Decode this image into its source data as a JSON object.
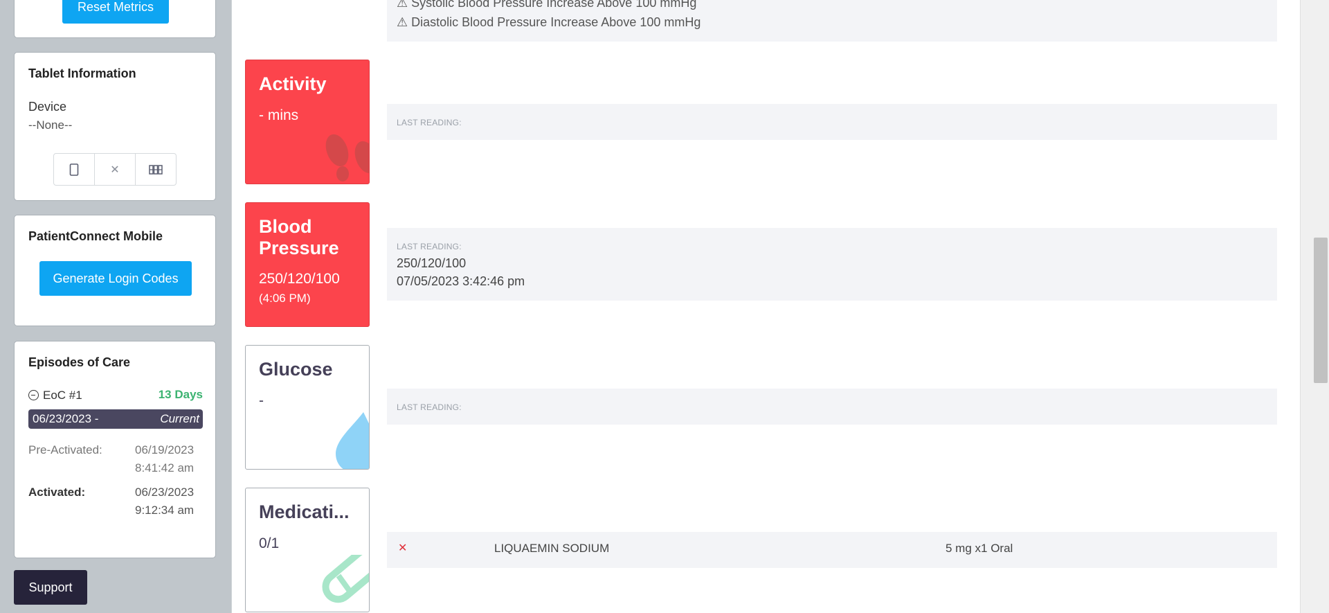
{
  "sidebar": {
    "reset_metrics": "Reset Metrics",
    "tablet": {
      "title": "Tablet Information",
      "device_label": "Device",
      "device_value": "--None--",
      "tablet_icon": "tablet-icon",
      "clear_icon": "close-icon",
      "grid_icon": "tablet-grid-icon"
    },
    "patient_connect": {
      "title": "PatientConnect Mobile",
      "button": "Generate Login Codes"
    },
    "episodes": {
      "title": "Episodes of Care",
      "eoc_label": "EoC #1",
      "eoc_days": "13 Days",
      "range_start": "06/23/2023 -",
      "range_end": "Current",
      "pre_activated_label": "Pre-Activated:",
      "pre_activated_date": "06/19/2023",
      "pre_activated_time": "8:41:42 am",
      "activated_label": "Activated:",
      "activated_date": "06/23/2023",
      "activated_time": "9:12:34 am"
    },
    "support": "Support"
  },
  "alerts": {
    "systolic": "Systolic Blood Pressure Increase Above 100 mmHg",
    "diastolic": "Diastolic Blood Pressure Increase Above 100 mmHg"
  },
  "tiles": {
    "activity": {
      "title": "Activity",
      "value": "- mins",
      "icon": "footprints-icon"
    },
    "bp": {
      "title_1": "Blood",
      "title_2": "Pressure",
      "value": "250/120/100",
      "time": "(4:06 PM)"
    },
    "glucose": {
      "title": "Glucose",
      "value": "-",
      "icon": "drop-icon"
    },
    "medication": {
      "title": "Medicati...",
      "value": "0/1",
      "icon": "pill-icon"
    }
  },
  "readings": {
    "last_reading_label": "LAST READING:",
    "bp_value": "250/120/100",
    "bp_timestamp": "07/05/2023 3:42:46 pm"
  },
  "medication_row": {
    "status_icon": "x-icon",
    "name": "LIQUAEMIN SODIUM",
    "dose": "5 mg x1 Oral"
  },
  "colors": {
    "accent_blue": "#0ea5f2",
    "alert_red": "#fc444c",
    "success_green": "#3cb371",
    "dark_navy": "#454058"
  }
}
